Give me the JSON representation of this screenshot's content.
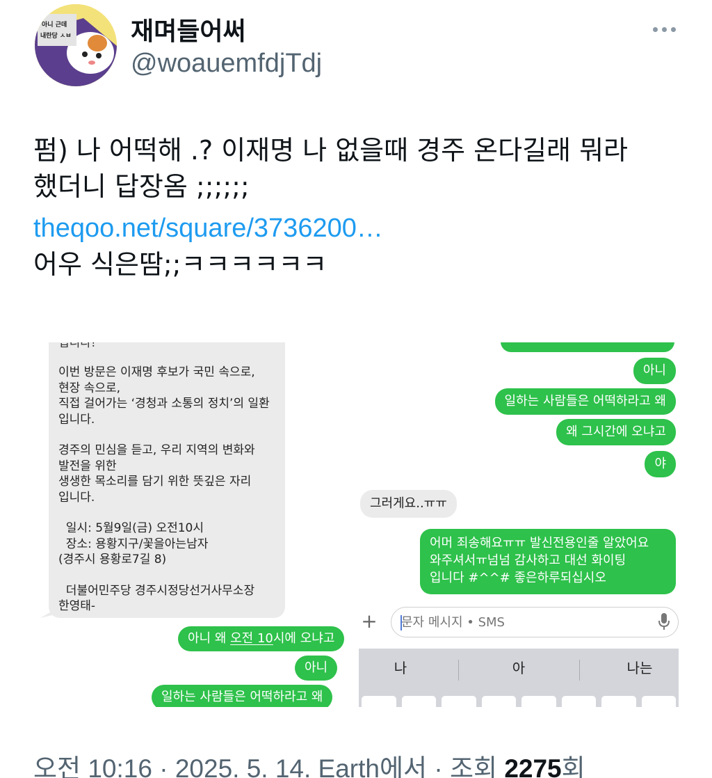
{
  "tweet": {
    "display_name": "재며들어써",
    "handle": "@woauemfdjTdj",
    "avatar_text_1": "아니 근데",
    "avatar_text_2": "내란당 ㅅㅂ",
    "body_lines": [
      "펌) 나 어떡해 .? 이재명 나 없을때 경주 온다길래 뭐라",
      "했더니 답장옴 ;;;;;;"
    ],
    "link": "theqoo.net/square/3736200…",
    "after_link": "어우 식은땀;;ㅋㅋㅋㅋㅋㅋ"
  },
  "left_screenshot": {
    "cut_top": "입니다!",
    "announcement": [
      "이번 방문은 이재명 후보가 국민 속으로,",
      "현장 속으로,",
      "직접 걸어가는 ‘경청과 소통의 정치’의 일환",
      "입니다.",
      "",
      "경주의 민심을 듣고, 우리 지역의 변화와",
      "발전을 위한",
      "생생한 목소리를 담기 위한 뜻깊은 자리",
      "입니다.",
      "",
      "  일시: 5월9일(금) 오전10시",
      "  장소: 용황지구/꽃을아는남자",
      "(경주시 용황로7길 8)",
      "",
      "  더불어민주당 경주시정당선거사무소장",
      "한영태-"
    ],
    "reply_1_pre": "아니 왜 ",
    "reply_1_under": "오전 10",
    "reply_1_post": "시에 오냐고",
    "reply_2": "아니",
    "reply_3": "일하는 사람들은 어떡하라고 왜"
  },
  "right_screenshot": {
    "messages": [
      "아니",
      "일하는 사람들은 어떡하라고 왜",
      "왜 그시간에 오냐고",
      "야"
    ],
    "incoming": "그러게요..ㅠㅠ",
    "reply": [
      "어머 죄송해요ㅠㅠ 발신전용인줄 알았어요",
      "와주셔서ㅠ넘넘 감사하고 대선 화이팅",
      "입니다 #^^# 좋은하루되십시오"
    ],
    "input_placeholder": "문자 메시지 • SMS",
    "suggestions": [
      "나",
      "아",
      "나는"
    ]
  },
  "footer": {
    "meta": "오전 10:16 · 2025. 5. 14. Earth에서 · 조회 ",
    "views": "2275",
    "views_suffix": "회"
  },
  "colors": {
    "link": "#1d9bf0",
    "bubble_green": "#2ec14b",
    "bubble_gray": "#ebebeb",
    "muted_text": "#536471"
  }
}
